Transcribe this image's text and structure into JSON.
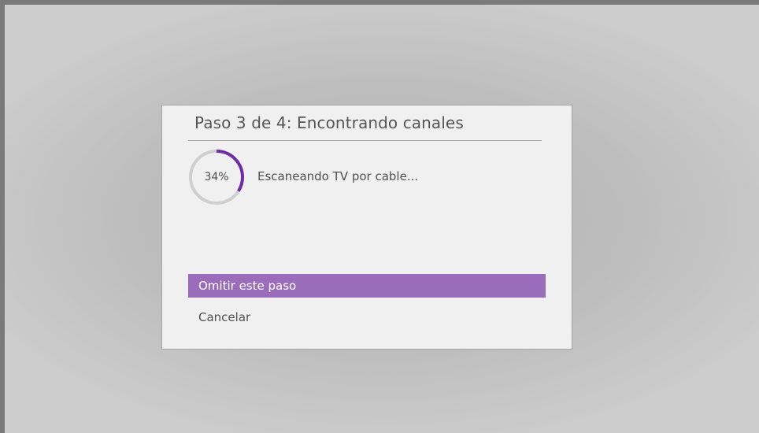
{
  "dialog": {
    "title": "Paso 3 de 4: Encontrando canales",
    "progress": {
      "percent": 34,
      "label": "34%",
      "track_color": "#cfcfcf",
      "fill_color": "#6f2da8"
    },
    "status": "Escaneando TV por cable...",
    "menu": {
      "skip_label": "Omitir este paso",
      "cancel_label": "Cancelar",
      "highlight_color": "#9a6cba"
    }
  }
}
